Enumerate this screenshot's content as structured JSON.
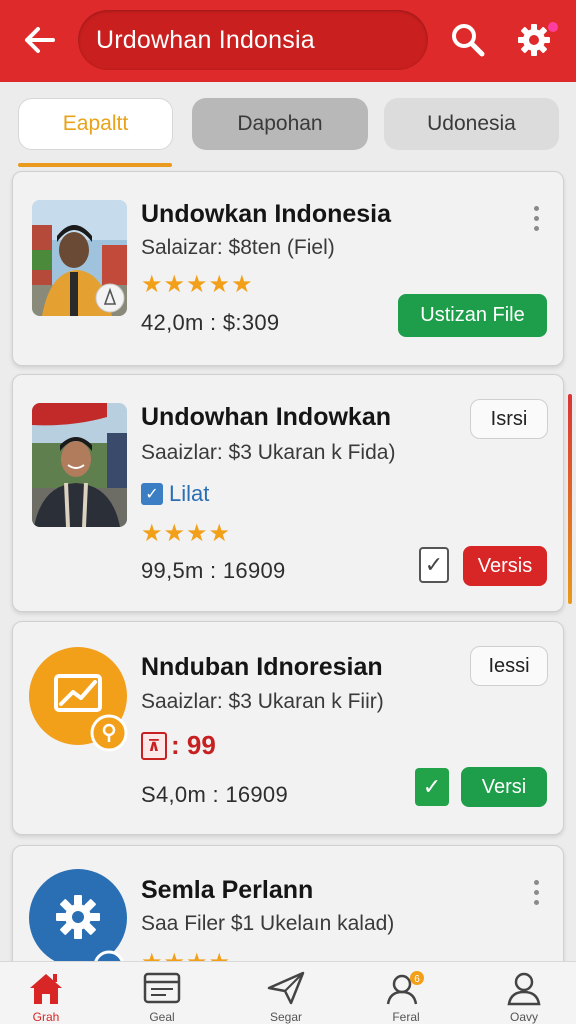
{
  "header": {
    "title": "Urdowhan Indonsia",
    "accent_color": "#de2a2a",
    "back_icon": "arrow-left-icon",
    "search_icon": "search-icon",
    "settings_icon": "gear-icon"
  },
  "tabs": [
    {
      "label": "Eapaltt",
      "active": true
    },
    {
      "label": "Dapohan",
      "active": false
    },
    {
      "label": "Udonesia",
      "active": false
    }
  ],
  "cards": [
    {
      "title": "Undowkan Indonesia",
      "subtitle": "Salaizar: $8ten (Fiel)",
      "rating_stars": 5,
      "meta": "42,0m : $:309",
      "action_label": "Ustizan File"
    },
    {
      "title": "Undowhan Indowkan",
      "subtitle": "Saaizlar: $3 Ukaran k Fida)",
      "badge_label": "Lilat",
      "rating_stars": 4,
      "meta": "99,5m : 16909",
      "outline_label": "Isrsi",
      "action_label": "Versis"
    },
    {
      "title": "Nnduban Idnoresian",
      "subtitle": "Saaizlar: $3 Ukaran k Fiir)",
      "price": ": 99",
      "meta": "S4,0m : 16909",
      "outline_label": "Iessi",
      "action_label": "Versi"
    },
    {
      "title": "Semla Perlann",
      "subtitle": "Saa Filer $1 Ukelaın kalad)",
      "rating_stars": 4
    }
  ],
  "bottom_nav": [
    {
      "icon": "home-icon",
      "label": "Grah",
      "active": true
    },
    {
      "icon": "browser-icon",
      "label": "Geal",
      "active": false
    },
    {
      "icon": "send-icon",
      "label": "Segar",
      "active": false
    },
    {
      "icon": "user-badge-icon",
      "label": "Feral",
      "active": false,
      "badge": "6"
    },
    {
      "icon": "profile-icon",
      "label": "Oavy",
      "active": false
    }
  ],
  "colors": {
    "star": "#f2a01a",
    "green": "#1e9e4a",
    "red": "#d82525",
    "orange": "#f29f1a",
    "blue": "#2a6fb4"
  }
}
